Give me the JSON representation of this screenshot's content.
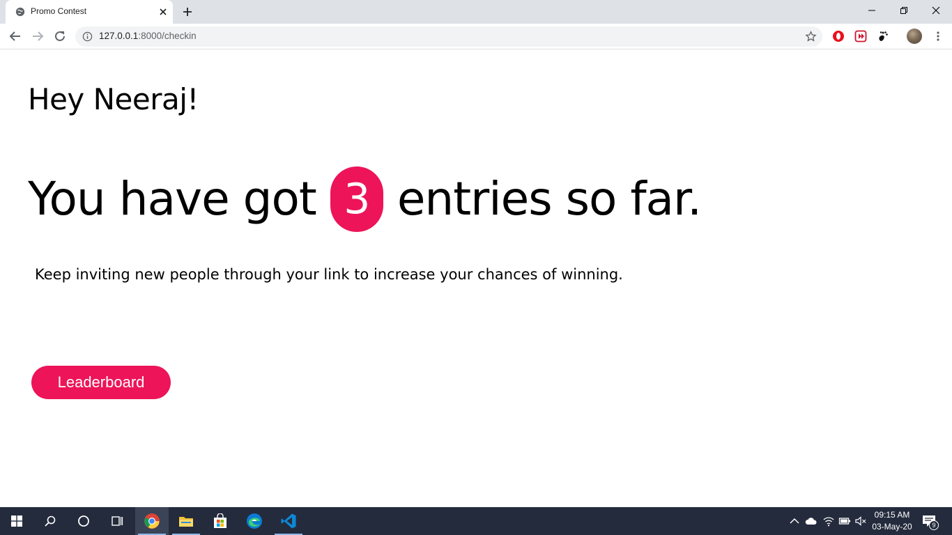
{
  "browser": {
    "tab_title": "Promo Contest",
    "url_host": "127.0.0.1",
    "url_rest": ":8000/checkin"
  },
  "page": {
    "greeting": "Hey Neeraj!",
    "headline_before": "You have got",
    "entries_count": "3",
    "headline_after": "entries so far.",
    "subtext": "Keep inviting new people through your link to increase your chances of winning.",
    "leaderboard_label": "Leaderboard",
    "accent_color": "#ed1459"
  },
  "taskbar": {
    "time": "09:15 AM",
    "date": "03-May-20",
    "notification_count": "9"
  }
}
